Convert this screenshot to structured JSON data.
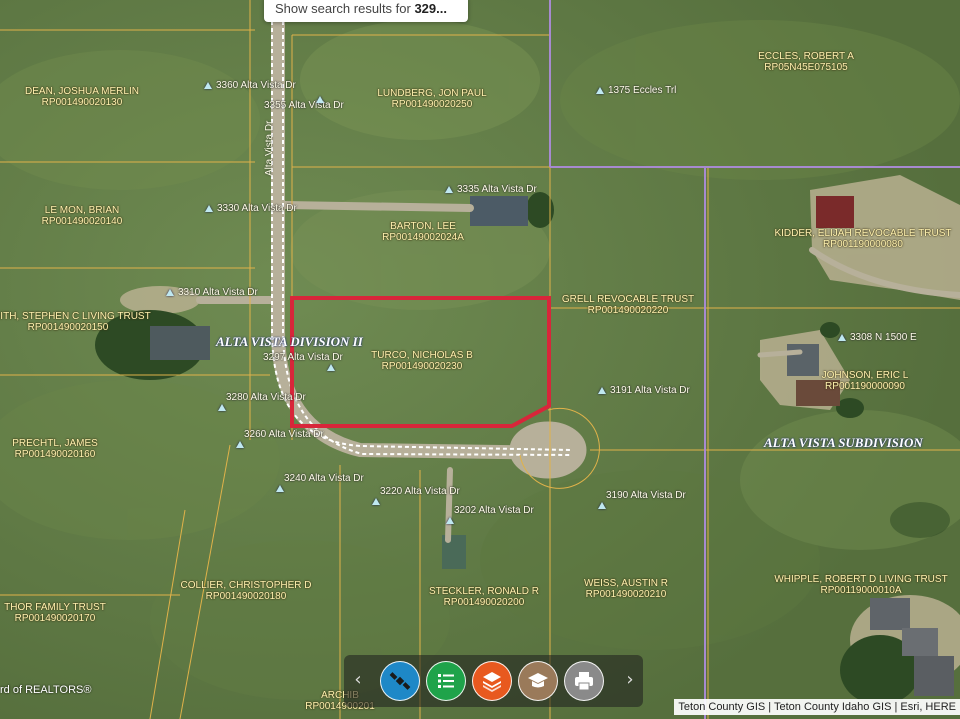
{
  "search_tip": {
    "prefix": "Show search results for ",
    "query": "329..."
  },
  "parcels": [
    {
      "owner": "DEAN, JOSHUA MERLIN",
      "pid": "RP001490020130"
    },
    {
      "owner": "LUNDBERG, JON PAUL",
      "pid": "RP001490020250"
    },
    {
      "owner": "ECCLES, ROBERT A",
      "pid": "RP05N45E075105"
    },
    {
      "owner": "LE MON, BRIAN",
      "pid": "RP001490020140"
    },
    {
      "owner": "BARTON, LEE",
      "pid": "RP00149002024A"
    },
    {
      "owner": "KIDDER, ELIJAH REVOCABLE TRUST",
      "pid": "RP001190000080"
    },
    {
      "owner": "SMITH, STEPHEN C LIVING TRUST",
      "pid": "RP001490020150"
    },
    {
      "owner": "GRELL REVOCABLE TRUST",
      "pid": "RP001490020220"
    },
    {
      "owner": "TURCO, NICHOLAS B",
      "pid": "RP001490020230"
    },
    {
      "owner": "JOHNSON, ERIC L",
      "pid": "RP001190000090"
    },
    {
      "owner": "PRECHTL, JAMES",
      "pid": "RP001490020160"
    },
    {
      "owner": "COLLIER, CHRISTOPHER D",
      "pid": "RP001490020180"
    },
    {
      "owner": "STECKLER, RONALD R",
      "pid": "RP001490020200"
    },
    {
      "owner": "WEISS, AUSTIN R",
      "pid": "RP001490020210"
    },
    {
      "owner": "WHIPPLE, ROBERT D LIVING TRUST",
      "pid": "RP00119000010A"
    },
    {
      "owner": "THOR FAMILY TRUST",
      "pid": "RP001490020170"
    },
    {
      "owner": "ARCHIB",
      "pid": "RP0014900201"
    }
  ],
  "addresses": [
    "3360 Alta Vista Dr",
    "3355 Alta Vista Dr",
    "1375 Eccles Trl",
    "3335 Alta Vista Dr",
    "3330 Alta Vista Dr",
    "3310 Alta Vista Dr",
    "3297 Alta Vista Dr",
    "3308 N 1500 E",
    "3280 Alta Vista Dr",
    "3191 Alta Vista Dr",
    "3260 Alta Vista Dr",
    "3240 Alta Vista Dr",
    "3220 Alta Vista Dr",
    "3202 Alta Vista Dr",
    "3190 Alta Vista Dr"
  ],
  "road_name": "Alta Vista Dr",
  "subdivisions": [
    "ALTA VISTA DIVISION II",
    "ALTA VISTA SUBDIVISION"
  ],
  "attribution": "Teton County GIS | Teton County Idaho GIS | Esri, HERE",
  "realtor_credit": "rd of REALTORS®",
  "toolbar": {
    "buttons": [
      {
        "name": "satellite-button",
        "icon": "satellite-icon",
        "color": "#1e88c7"
      },
      {
        "name": "list-button",
        "icon": "list-icon",
        "color": "#1fa34a"
      },
      {
        "name": "layers-button",
        "icon": "layers-icon",
        "color": "#e8591f"
      },
      {
        "name": "schools-button",
        "icon": "graduation-cap-icon",
        "color": "#9a7a5a"
      },
      {
        "name": "print-button",
        "icon": "printer-icon",
        "color": "#8a8a8a"
      }
    ],
    "prev": "‹",
    "next": "›"
  },
  "colors": {
    "highlight": "#d8263a",
    "parcel_line": "#e0b24a",
    "road": "#b7b09a",
    "subdivision_line": "#a78ad0"
  }
}
